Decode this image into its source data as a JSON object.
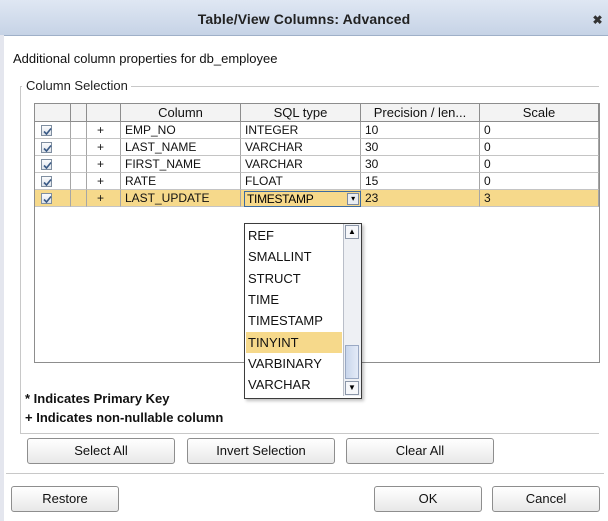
{
  "window": {
    "title": "Table/View Columns: Advanced",
    "close_glyph": "✖"
  },
  "description": "Additional column properties for db_employee",
  "column_selection": {
    "label": "Column Selection",
    "headers": [
      "",
      "",
      "",
      "Column",
      "SQL type",
      "Precision / len...",
      "Scale"
    ],
    "rows": [
      {
        "checked": true,
        "flag": "+",
        "column": "EMP_NO",
        "sql_type": "INTEGER",
        "precision": "10",
        "scale": "0",
        "selected": false
      },
      {
        "checked": true,
        "flag": "+",
        "column": "LAST_NAME",
        "sql_type": "VARCHAR",
        "precision": "30",
        "scale": "0",
        "selected": false
      },
      {
        "checked": true,
        "flag": "+",
        "column": "FIRST_NAME",
        "sql_type": "VARCHAR",
        "precision": "30",
        "scale": "0",
        "selected": false
      },
      {
        "checked": true,
        "flag": "+",
        "column": "RATE",
        "sql_type": "FLOAT",
        "precision": "15",
        "scale": "0",
        "selected": false
      },
      {
        "checked": true,
        "flag": "+",
        "column": "LAST_UPDATE",
        "sql_type": "TIMESTAMP",
        "precision": "23",
        "scale": "3",
        "selected": true
      }
    ]
  },
  "sql_type_dropdown": {
    "current_value": "TIMESTAMP",
    "options": [
      "REF",
      "SMALLINT",
      "STRUCT",
      "TIME",
      "TIMESTAMP",
      "TINYINT",
      "VARBINARY",
      "VARCHAR"
    ],
    "highlighted": "TINYINT"
  },
  "notes": {
    "primary_key": "* Indicates Primary Key",
    "non_nullable": "+ Indicates non-nullable column"
  },
  "buttons": {
    "select_all": "Select All",
    "invert_selection": "Invert Selection",
    "clear_all": "Clear All",
    "restore": "Restore",
    "ok": "OK",
    "cancel": "Cancel"
  },
  "colors": {
    "selection": "#f6d98b",
    "title_bar": "#c6d3e6"
  }
}
